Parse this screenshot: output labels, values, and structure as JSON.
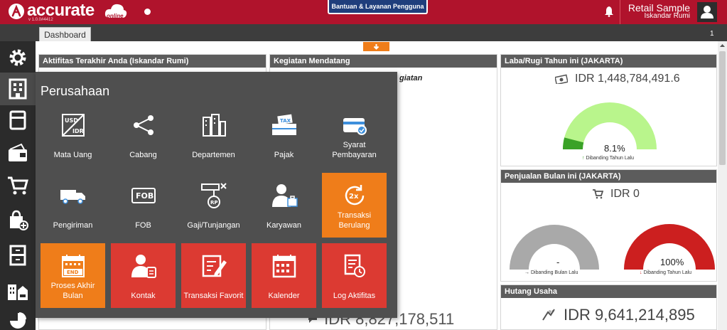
{
  "app": {
    "logo_text": "accurate",
    "logo_sub": "online",
    "version": "v 1.0.0#4412",
    "help_button": "Bantuan & Layanan Pengguna",
    "company": "Retail Sample",
    "user": "Iskandar Rumi"
  },
  "tabs": {
    "dashboard": "Dashboard",
    "page_number": "1"
  },
  "sidebar": {
    "items": [
      "settings-icon",
      "company-icon",
      "ledger-icon",
      "bank-icon",
      "cart-icon",
      "purchase-icon",
      "inventory-icon",
      "assets-icon",
      "report-icon"
    ]
  },
  "panels": {
    "activities_title": "Aktifitas Terakhir Anda (Iskandar Rumi)",
    "upcoming_title": "Kegiatan Mendatang",
    "upcoming_partial_text": "giatan",
    "profit_title": "Laba/Rugi Tahun ini (JAKARTA)",
    "profit_value": "IDR 1,448,784,491.6",
    "profit_pct": "8.1%",
    "profit_pct_fill": 0.081,
    "profit_compare": "Dibanding Tahun Lalu",
    "sales_title": "Penjualan Bulan ini (JAKARTA)",
    "sales_value": "IDR 0",
    "sales_left_label": "-",
    "sales_left_compare": "Dibanding Bulan Lalu",
    "sales_right_label": "100%",
    "sales_right_fill": 1.0,
    "sales_right_compare": "Dibanding Tahun Lalu",
    "debt_title": "Hutang Usaha",
    "debt_value": "IDR 9,641,214,895",
    "middle_bottom_value": "IDR 8,827,178,511"
  },
  "overlay": {
    "title": "Perusahaan",
    "tiles": [
      {
        "label": "Mata Uang",
        "icon": "currency-icon",
        "color": "blue"
      },
      {
        "label": "Cabang",
        "icon": "branch-icon",
        "color": "blue"
      },
      {
        "label": "Departemen",
        "icon": "building-icon",
        "color": "blue"
      },
      {
        "label": "Pajak",
        "icon": "tax-icon",
        "color": "blue"
      },
      {
        "label": "Syarat Pembayaran",
        "icon": "payment-terms-icon",
        "color": "blue"
      },
      {
        "label": "Pengiriman",
        "icon": "truck-icon",
        "color": "blue"
      },
      {
        "label": "FOB",
        "icon": "fob-icon",
        "color": "blue"
      },
      {
        "label": "Gaji/Tunjangan",
        "icon": "salary-icon",
        "color": "blue"
      },
      {
        "label": "Karyawan",
        "icon": "employee-icon",
        "color": "blue"
      },
      {
        "label": "Transaksi Berulang",
        "icon": "recurring-icon",
        "color": "orange"
      },
      {
        "label": "Proses Akhir Bulan",
        "icon": "calendar-end-icon",
        "color": "orange"
      },
      {
        "label": "Kontak",
        "icon": "contact-icon",
        "color": "red"
      },
      {
        "label": "Transaksi Favorit",
        "icon": "favorite-edit-icon",
        "color": "red"
      },
      {
        "label": "Kalender",
        "icon": "calendar-icon",
        "color": "red"
      },
      {
        "label": "Log Aktifitas",
        "icon": "activity-log-icon",
        "color": "red"
      }
    ]
  },
  "colors": {
    "brand": "#b0132c",
    "tile_blue": "#3d8fdc",
    "tile_orange": "#ef7d1a",
    "tile_red": "#dc3a32",
    "gauge_green": "#b9f58c",
    "gauge_green_fill": "#3aa227",
    "gauge_grey": "#a9a9a9",
    "gauge_red": "#cc1f1f"
  }
}
